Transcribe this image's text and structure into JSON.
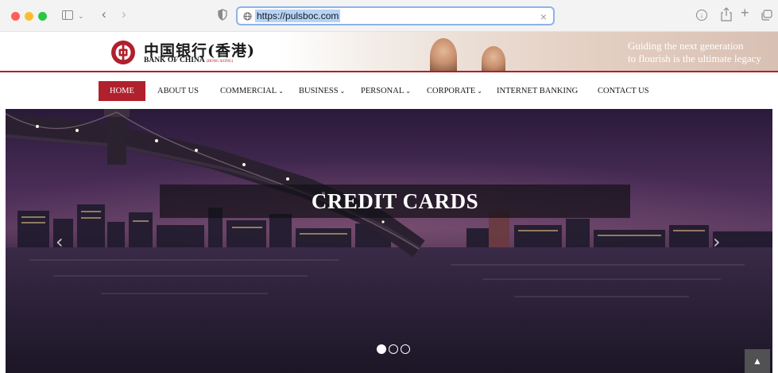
{
  "browser": {
    "url": "https://pulsboc.com",
    "icons": [
      "sidebar-icon",
      "chevron-down-icon",
      "back-icon",
      "forward-icon",
      "privacy-shield-icon",
      "globe-icon",
      "clear-icon",
      "download-icon",
      "share-icon",
      "new-tab-icon",
      "tab-overview-icon"
    ],
    "glyphs": {
      "chevron": "⌄",
      "back": "‹",
      "forward": "›",
      "clear": "×",
      "download": "↓",
      "plus": "+"
    }
  },
  "header": {
    "bank_name_cn": "中国银行(香港)",
    "bank_name_en": "BANK OF CHINA",
    "bank_name_en_sub": "(HONG KONG)",
    "tagline_line1": "Guiding the next generation",
    "tagline_line2": "to flourish is the ultimate legacy",
    "brand_color": "#b0202d"
  },
  "nav": {
    "home": "HOME",
    "about": "ABOUT US",
    "commercial": "COMMERCIAL",
    "business": "BUSINESS",
    "personal": "PERSONAL",
    "corporate": "CORPORATE",
    "internet_banking": "INTERNET BANKING",
    "contact": "CONTACT US",
    "dropdown_glyph": "⌄"
  },
  "hero": {
    "title": "CREDIT CARDS",
    "prev_glyph": "‹",
    "next_glyph": "›",
    "slide_count": 3,
    "active_slide": 1,
    "scroll_top_glyph": "▲"
  }
}
